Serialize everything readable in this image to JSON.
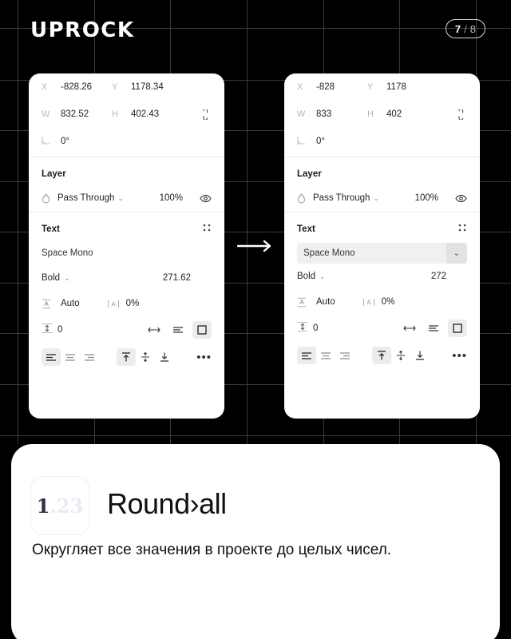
{
  "header": {
    "logo": "UPROCK",
    "page_current": "7",
    "page_separator": "/",
    "page_total": "8"
  },
  "transition": {
    "arrow_icon": "arrow-right-icon"
  },
  "panels": [
    {
      "id": "before",
      "properties": {
        "x_label": "X",
        "x_value": "-828.26",
        "y_label": "Y",
        "y_value": "1178.34",
        "w_label": "W",
        "w_value": "832.52",
        "h_label": "H",
        "h_value": "402.43",
        "rotation_label": "rotation-icon",
        "rotation_value": "0°",
        "lock_icon": "proportion-unlock-icon"
      },
      "layer": {
        "title": "Layer",
        "blend_icon": "blend-mode-icon",
        "blend_mode": "Pass Through",
        "chevron": "chevron-down-icon",
        "opacity": "100%",
        "visibility_icon": "eye-icon"
      },
      "text": {
        "title": "Text",
        "settings_icon": "type-settings-icon",
        "font_family": "Space Mono",
        "font_family_boxed": false,
        "font_weight": "Bold",
        "weight_chevron": "chevron-down-icon",
        "font_size": "271.62",
        "line_height_icon": "line-height-icon",
        "line_height": "Auto",
        "letter_spacing_icon": "letter-spacing-icon",
        "letter_spacing": "0%",
        "paragraph_icon": "paragraph-spacing-icon",
        "paragraph_spacing": "0",
        "resize_horizontal_icon": "auto-width-icon",
        "resize_auto_icon": "auto-height-icon",
        "resize_fixed_icon": "fixed-size-icon",
        "align_left_icon": "align-left-icon",
        "align_center_icon": "align-center-icon",
        "align_right_icon": "align-right-icon",
        "valign_top_icon": "align-top-icon",
        "valign_middle_icon": "align-middle-icon",
        "valign_bottom_icon": "align-bottom-icon",
        "more_icon": "more-options-icon"
      }
    },
    {
      "id": "after",
      "properties": {
        "x_label": "X",
        "x_value": "-828",
        "y_label": "Y",
        "y_value": "1178",
        "w_label": "W",
        "w_value": "833",
        "h_label": "H",
        "h_value": "402",
        "rotation_label": "rotation-icon",
        "rotation_value": "0°",
        "lock_icon": "proportion-unlock-icon"
      },
      "layer": {
        "title": "Layer",
        "blend_icon": "blend-mode-icon",
        "blend_mode": "Pass Through",
        "chevron": "chevron-down-icon",
        "opacity": "100%",
        "visibility_icon": "eye-icon"
      },
      "text": {
        "title": "Text",
        "settings_icon": "type-settings-icon",
        "font_family": "Space Mono",
        "font_family_boxed": true,
        "font_weight": "Bold",
        "weight_chevron": "chevron-down-icon",
        "font_size": "272",
        "line_height_icon": "line-height-icon",
        "line_height": "Auto",
        "letter_spacing_icon": "letter-spacing-icon",
        "letter_spacing": "0%",
        "paragraph_icon": "paragraph-spacing-icon",
        "paragraph_spacing": "0",
        "resize_horizontal_icon": "auto-width-icon",
        "resize_auto_icon": "auto-height-icon",
        "resize_fixed_icon": "fixed-size-icon",
        "align_left_icon": "align-left-icon",
        "align_center_icon": "align-center-icon",
        "align_right_icon": "align-right-icon",
        "valign_top_icon": "align-top-icon",
        "valign_middle_icon": "align-middle-icon",
        "valign_bottom_icon": "align-bottom-icon",
        "more_icon": "more-options-icon"
      }
    }
  ],
  "card": {
    "icon_primary": "1",
    "icon_secondary": ".23",
    "title": "Round›all",
    "description": "Округляет все значения в проекте до целых чисел."
  },
  "colors": {
    "background": "#000000",
    "panel": "#ffffff",
    "grid_line": "#3a3a3a",
    "label_gray": "#b6b6b6",
    "text_dark": "#222222",
    "icon_muted": "#e7ecf3"
  }
}
